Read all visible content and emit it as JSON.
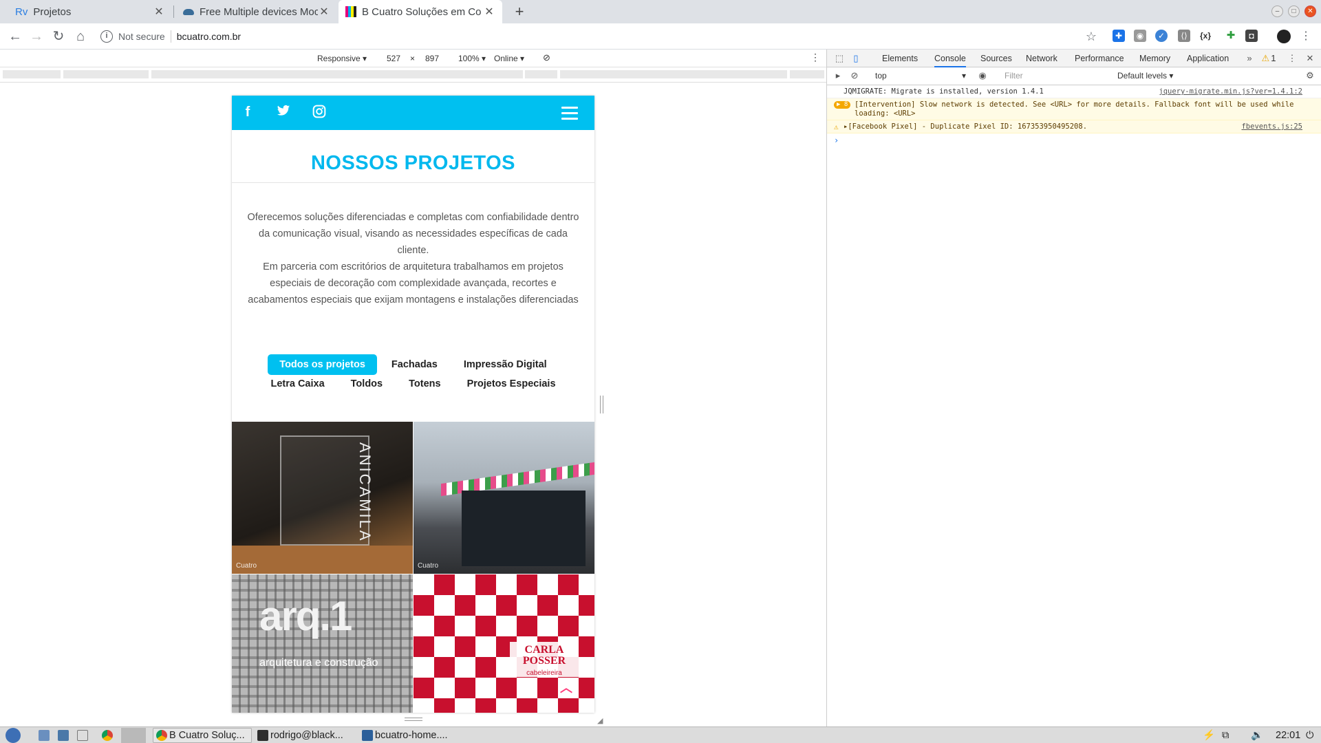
{
  "browser": {
    "tabs": [
      {
        "title": "Projetos",
        "favicon_text": "Rv"
      },
      {
        "title": "Free Multiple devices Moc"
      },
      {
        "title": "B Cuatro Soluções em Co"
      }
    ],
    "security_label": "Not secure",
    "url": "bcuatro.com.br"
  },
  "device_toolbar": {
    "mode": "Responsive",
    "width": "527",
    "times": "×",
    "height": "897",
    "zoom": "100%",
    "network": "Online"
  },
  "page": {
    "brand_color": "#00c0f0",
    "title": "NOSSOS PROJETOS",
    "intro": "Oferecemos soluções diferenciadas e completas com confiabilidade dentro da comunicação visual, visando as necessidades específicas de cada cliente.\nEm parceria com escritórios de arquitetura trabalhamos em projetos especiais de decoração com complexidade avançada, recortes e acabamentos especiais que exijam montagens e instalações diferenciadas",
    "filters_row1": [
      "Todos os projetos",
      "Fachadas",
      "Impressão Digital"
    ],
    "filters_row2": [
      "Letra Caixa",
      "Toldos",
      "Totens",
      "Projetos Especiais"
    ],
    "tiles": [
      {
        "text": "ANICAMILA",
        "watermark": "Cuatro"
      },
      {
        "text": "",
        "watermark": "Cuatro"
      },
      {
        "text": "arq.1",
        "subtext": "arquitetura e construção"
      },
      {
        "text": "CARLA POSSER",
        "subtext": "cabeleireira"
      }
    ]
  },
  "devtools": {
    "tabs": [
      "Elements",
      "Console",
      "Sources",
      "Network",
      "Performance",
      "Memory",
      "Application"
    ],
    "active_tab": "Console",
    "warning_count": "1",
    "context": "top",
    "filter_placeholder": "Filter",
    "levels": "Default levels",
    "messages": [
      {
        "text": "JQMIGRATE: Migrate is installed, version 1.4.1",
        "source": "jquery-migrate.min.js?ver=1.4.1:2",
        "level": "info"
      },
      {
        "text": "[Intervention] Slow network is detected. See <URL> for more details. Fallback font will be used while loading: <URL>",
        "badge": "8",
        "level": "warning"
      },
      {
        "text": "[Facebook Pixel] - Duplicate Pixel ID: 167353950495208.",
        "source": "fbevents.js:25",
        "level": "warning"
      }
    ]
  },
  "taskbar": {
    "tasks": [
      "B Cuatro Soluç...",
      "rodrigo@black...",
      "bcuatro-home...."
    ],
    "clock": "22:01"
  }
}
